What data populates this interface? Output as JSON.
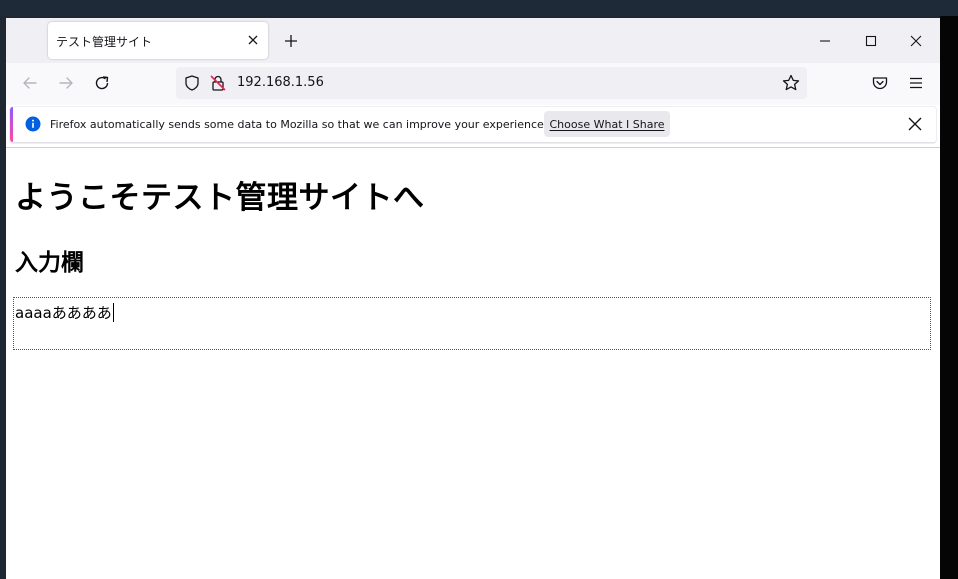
{
  "browser": {
    "tab": {
      "title": "テスト管理サイト"
    },
    "address": {
      "url": "192.168.1.56"
    }
  },
  "notification": {
    "message": "Firefox automatically sends some data to Mozilla so that we can improve your experience.",
    "button_label": "Choose What I Share"
  },
  "page": {
    "heading": "ようこそテスト管理サイトへ",
    "section_heading": "入力欄",
    "input_value": "aaaaああああ"
  },
  "colors": {
    "accent": "#0060df",
    "notify_gradient_start": "#9059ff",
    "notify_gradient_end": "#ff4aa2",
    "insecure_strike": "#e22850"
  }
}
